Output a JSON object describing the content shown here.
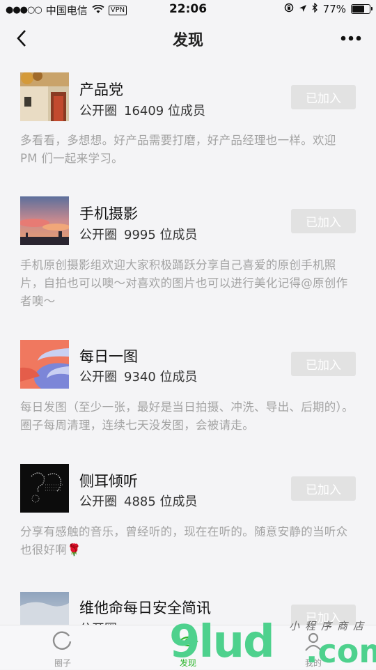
{
  "status_bar": {
    "signal": "●●●○○",
    "carrier": "中国电信",
    "vpn": "VPN",
    "time": "22:06",
    "battery": "77%",
    "battery_level": 0.77
  },
  "nav": {
    "title": "发现"
  },
  "groups": [
    {
      "name": "产品党",
      "type": "公开圈",
      "members": "16409 位成员",
      "action": "已加入",
      "desc": "多看看，多想想。好产品需要打磨，好产品经理也一样。欢迎 PM 们一起来学习。"
    },
    {
      "name": "手机摄影",
      "type": "公开圈",
      "members": "9995 位成员",
      "action": "已加入",
      "desc": "手机原创摄影组欢迎大家积极踊跃分享自己喜爱的原创手机照片，自拍也可以噢～对喜欢的图片也可以进行美化记得@原创作者噢～"
    },
    {
      "name": "每日一图",
      "type": "公开圈",
      "members": "9340 位成员",
      "action": "已加入",
      "desc": "每日发图（至少一张，最好是当日拍摄、冲洗、导出、后期的）。圈子每周清理，连续七天没发图，会被请走。"
    },
    {
      "name": "侧耳倾听",
      "type": "公开圈",
      "members": "4885 位成员",
      "action": "已加入",
      "desc": "分享有感触的音乐，曾经听的，现在在听的。随意安静的当听众也很好啊",
      "emoji": "🌹"
    },
    {
      "name": "维他命每日安全简讯",
      "type": "公开圈",
      "members": "",
      "action": "已加入",
      "desc": ""
    }
  ],
  "tabs": [
    {
      "label": "圈子"
    },
    {
      "label": "发现"
    },
    {
      "label": "我的"
    }
  ],
  "watermark": {
    "brand": "9lud",
    "slogan": "小程序商店",
    "suffix": ".com"
  }
}
